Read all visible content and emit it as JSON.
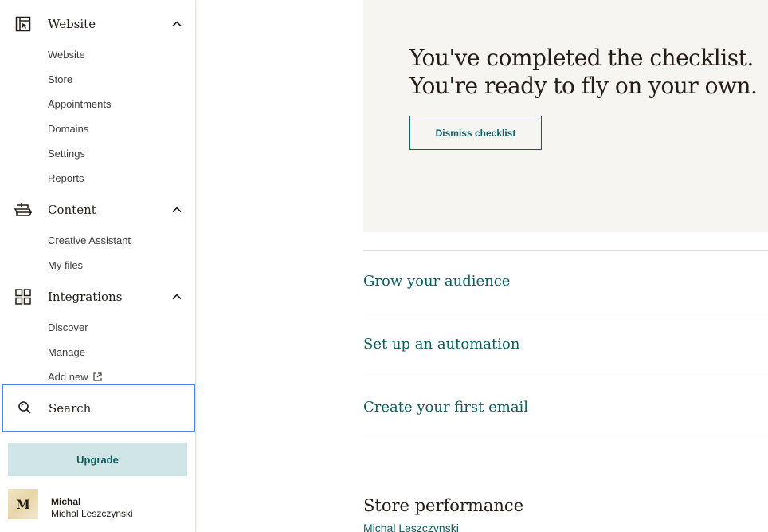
{
  "sidebar": {
    "sections": [
      {
        "label": "Website",
        "icon": "website-layout-icon",
        "expanded": true,
        "items": [
          "Website",
          "Store",
          "Appointments",
          "Domains",
          "Settings",
          "Reports"
        ]
      },
      {
        "label": "Content",
        "icon": "content-stack-icon",
        "expanded": true,
        "items": [
          "Creative Assistant",
          "My files"
        ]
      },
      {
        "label": "Integrations",
        "icon": "grid-icon",
        "expanded": true,
        "items": [
          "Discover",
          "Manage",
          "Add new"
        ]
      }
    ],
    "search": {
      "label": "Search",
      "icon": "search-icon"
    },
    "upgrade": {
      "label": "Upgrade"
    },
    "profile": {
      "avatar_letter": "M",
      "name": "Michal",
      "fullname": "Michal Leszczynski"
    }
  },
  "main": {
    "checklist": {
      "line1": "You've completed the checklist.",
      "line2": "You're ready to fly on your own.",
      "dismiss_label": "Dismiss checklist"
    },
    "tasks": [
      "Grow your audience",
      "Set up an automation",
      "Create your first email"
    ],
    "store": {
      "title": "Store performance",
      "subtitle": "Michal Leszczynski"
    }
  },
  "colors": {
    "accent": "#0b5f61",
    "upgrade_bg": "#d0e5e6",
    "card_bg": "#f6f5f2",
    "focus_outline": "#4a86e8"
  }
}
